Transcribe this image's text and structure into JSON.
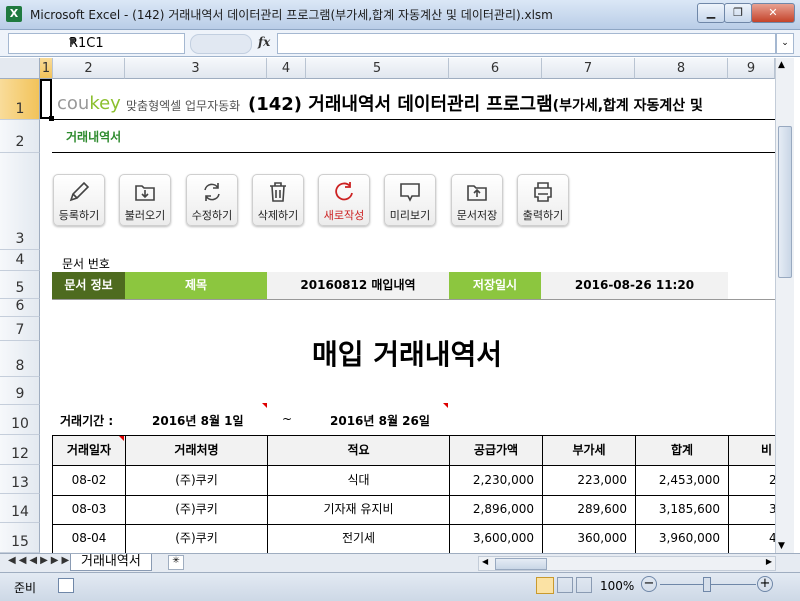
{
  "window": {
    "app_icon": "X",
    "title": "Microsoft Excel - (142) 거래내역서 데이터관리 프로그램(부가세,합계 자동계산 및 데이터관리).xlsm",
    "controls": {
      "minimize": "▁",
      "restore": "❐",
      "close": "✕"
    }
  },
  "formula_bar": {
    "name_box": "R1C1",
    "fx": "fx",
    "content": ""
  },
  "columns": [
    "1",
    "2",
    "3",
    "4",
    "5",
    "6",
    "7",
    "8",
    "9"
  ],
  "rows": [
    "1",
    "2",
    "3",
    "4",
    "5",
    "6",
    "7",
    "8",
    "9",
    "10",
    "12",
    "13",
    "14",
    "15"
  ],
  "sheet": {
    "logo_text": "cou",
    "logo_accent": "key",
    "logo_sub": "맞춤형엑셀 업무자동화",
    "main_title": "(142) 거래내역서 데이터관리 프로그램",
    "main_title_sub": "(부가세,합계 자동계산 및",
    "subheader": "거래내역서",
    "toolbar": [
      {
        "label": "등록하기",
        "icon": "pencil-icon"
      },
      {
        "label": "불러오기",
        "icon": "download-icon"
      },
      {
        "label": "수정하기",
        "icon": "refresh-icon"
      },
      {
        "label": "삭제하기",
        "icon": "trash-icon"
      },
      {
        "label": "새로작성",
        "icon": "new-icon"
      },
      {
        "label": "미리보기",
        "icon": "monitor-icon"
      },
      {
        "label": "문서저장",
        "icon": "upload-icon"
      },
      {
        "label": "출력하기",
        "icon": "printer-icon"
      }
    ],
    "doc_no_label": "문서 번호",
    "doc_info_label": "문서 정보",
    "subject_label": "제목",
    "subject_value": "20160812 매입내역",
    "saved_label": "저장일시",
    "saved_value": "2016-08-26 11:20",
    "doc_title": "매입 거래내역서",
    "period_label": "거래기간 :",
    "period_start": "2016년 8월 1일",
    "period_sep": "~",
    "period_end": "2016년 8월 26일",
    "table": {
      "headers": [
        "거래일자",
        "거래처명",
        "적요",
        "공급가액",
        "부가세",
        "합계",
        "비"
      ],
      "rows": [
        [
          "08-02",
          "(주)쿠키",
          "식대",
          "2,230,000",
          "223,000",
          "2,453,000",
          "2"
        ],
        [
          "08-03",
          "(주)쿠키",
          "기자재 유지비",
          "2,896,000",
          "289,600",
          "3,185,600",
          "3"
        ],
        [
          "08-04",
          "(주)쿠키",
          "전기세",
          "3,600,000",
          "360,000",
          "3,960,000",
          "4"
        ]
      ]
    }
  },
  "sheet_tab": "거래내역서",
  "status": {
    "ready": "준비",
    "zoom": "100%"
  },
  "colors": {
    "dark_green": "#4e6b1f",
    "lime": "#8cc63f",
    "accent_red": "#cc2222"
  }
}
